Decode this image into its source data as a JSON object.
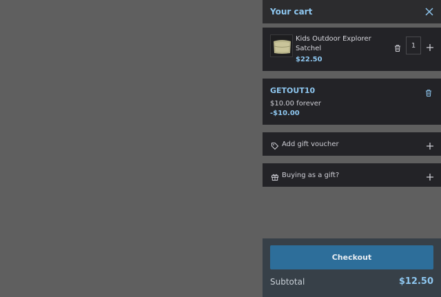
{
  "cart": {
    "title": "Your cart",
    "close_icon": "close-icon"
  },
  "item": {
    "name": "Kids Outdoor Explorer Satchel",
    "price": "$22.50",
    "quantity": "1",
    "delete_icon": "trash-icon",
    "add_icon": "plus-icon"
  },
  "coupon": {
    "code": "GETOUT10",
    "description": "$10.00 forever",
    "amount": "-$10.00",
    "delete_icon": "trash-icon"
  },
  "voucher": {
    "label": "Add gift voucher",
    "icon": "tag-icon",
    "add_icon": "plus-icon"
  },
  "gift": {
    "label": "Buying as a gift?",
    "icon": "gift-icon",
    "add_icon": "plus-icon"
  },
  "footer": {
    "checkout_label": "Checkout",
    "subtotal_label": "Subtotal",
    "subtotal_value": "$12.50"
  },
  "colors": {
    "accent": "#8ec7f0",
    "checkout": "#2d6e9a",
    "backdrop": "#5f5f5f",
    "card": "#232327"
  }
}
